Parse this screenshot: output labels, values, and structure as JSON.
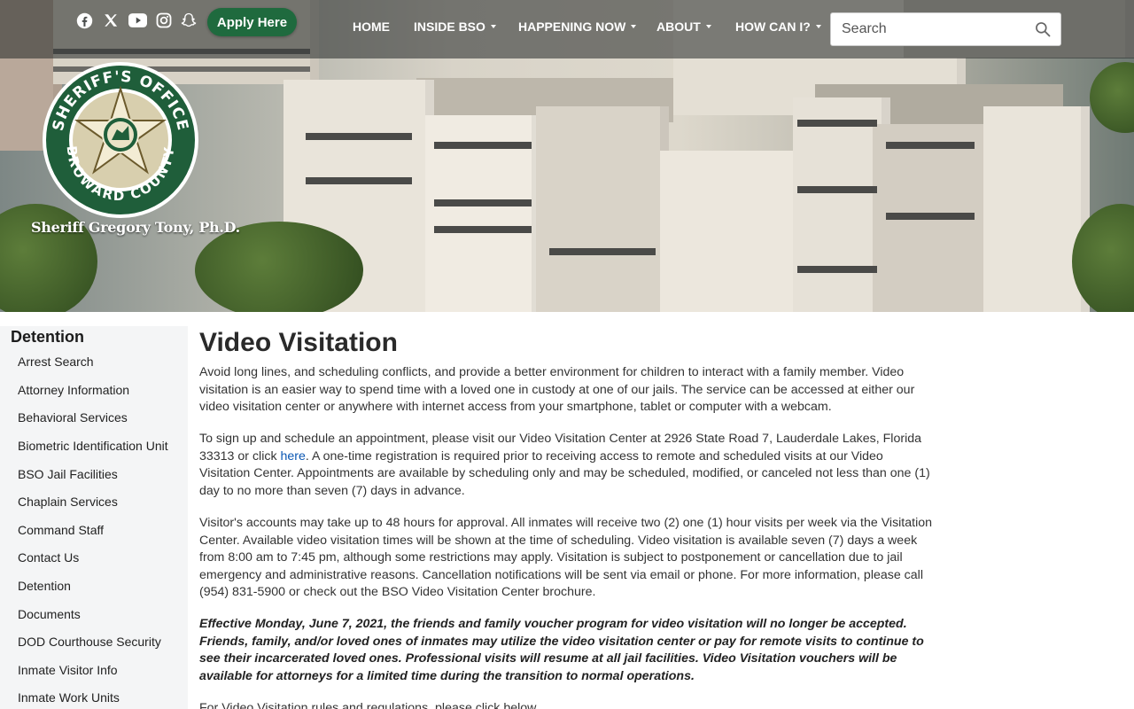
{
  "topbar": {
    "social": [
      {
        "name": "facebook-icon"
      },
      {
        "name": "x-icon"
      },
      {
        "name": "youtube-icon"
      },
      {
        "name": "instagram-icon"
      },
      {
        "name": "snapchat-icon"
      }
    ],
    "apply_label": "Apply Here",
    "nav": [
      {
        "label": "HOME",
        "dropdown": false
      },
      {
        "label": "INSIDE BSO",
        "dropdown": true
      },
      {
        "label": "HAPPENING NOW",
        "dropdown": true
      },
      {
        "label": "ABOUT",
        "dropdown": true
      },
      {
        "label": "HOW CAN I?",
        "dropdown": true
      }
    ],
    "search": {
      "placeholder": "Search",
      "value": ""
    }
  },
  "logo": {
    "seal_text_top": "SHERIFF'S OFFICE",
    "seal_text_bottom": "BROWARD COUNTY",
    "sheriff_name": "Sheriff Gregory Tony, Ph.D."
  },
  "sidebar": {
    "title": "Detention",
    "items": [
      {
        "label": "Arrest Search"
      },
      {
        "label": "Attorney Information"
      },
      {
        "label": "Behavioral Services"
      },
      {
        "label": "Biometric Identification Unit"
      },
      {
        "label": "BSO Jail Facilities"
      },
      {
        "label": "Chaplain Services"
      },
      {
        "label": "Command Staff"
      },
      {
        "label": "Contact Us"
      },
      {
        "label": "Detention"
      },
      {
        "label": "Documents"
      },
      {
        "label": "DOD Courthouse Security"
      },
      {
        "label": "Inmate Visitor Info"
      },
      {
        "label": "Inmate Work Units"
      }
    ]
  },
  "main": {
    "title": "Video Visitation",
    "p1": "Avoid long lines, and scheduling conflicts, and provide a better environment for children to interact with a family member. Video visitation is an easier way to spend time with a loved one in custody at one of our jails. The service can be accessed at either our video visitation center or anywhere with internet access from your smartphone, tablet or computer with a webcam.",
    "p2_before": "To sign up and schedule an appointment, please visit our Video Visitation Center at 2926 State Road 7, Lauderdale Lakes, Florida 33313 or click ",
    "p2_link": "here",
    "p2_after": ". A one-time registration is required prior to receiving access to remote and scheduled visits at our Video Visitation Center. Appointments are available by scheduling only and may be scheduled, modified, or canceled not less than one (1) day to no more than seven (7) days in advance.",
    "p3": "Visitor's accounts may take up to 48 hours for approval. All inmates will receive two (2) one (1) hour visits per week via the Visitation Center. Available video visitation times will be shown at the time of scheduling. Video visitation is available seven (7) days a week from 8:00 am to 7:45 pm, although some restrictions may apply. Visitation is subject to postponement or cancellation due to jail emergency and administrative reasons. Cancellation notifications will be sent via email or phone. For more information, please call (954) 831-5900 or check out the BSO Video Visitation Center brochure.",
    "p4": "Effective Monday, June 7, 2021, the friends and family voucher program for video visitation will no longer be accepted. Friends, family, and/or loved ones of inmates may utilize the video visitation center or pay for remote visits to continue to see their incarcerated loved ones. Professional visits will resume at all jail facilities. Video Visitation vouchers will be available for attorneys for a limited time during the transition to normal operations.",
    "p5": "For Video Visitation rules and regulations, please click below."
  },
  "colors": {
    "apply_green": "#1f6a3e",
    "seal_green": "#1f5e3a",
    "link_blue": "#0b57b3",
    "sidebar_bg": "#f4f5f6"
  }
}
